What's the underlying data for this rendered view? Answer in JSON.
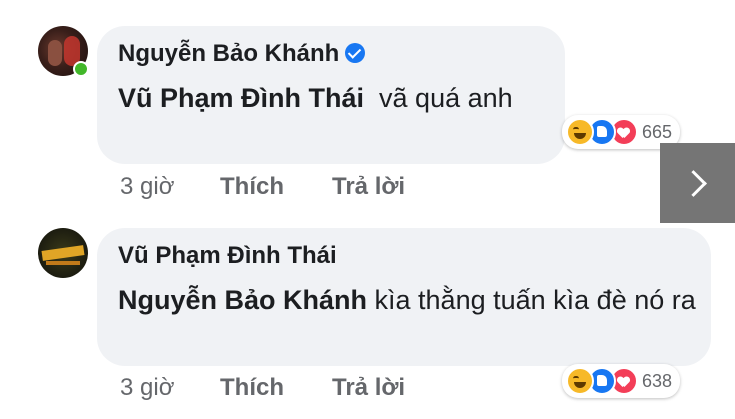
{
  "comments": [
    {
      "author": "Nguyễn Bảo Khánh",
      "verified": true,
      "mention": "Vũ Phạm Đình Thái",
      "text": "  vã quá anh",
      "reaction_count": "665",
      "time": "3 giờ",
      "like_label": "Thích",
      "reply_label": "Trả lời",
      "reaction_icons": [
        "haha-icon",
        "like-icon",
        "love-icon"
      ]
    },
    {
      "author": "Vũ Phạm Đình Thái",
      "verified": false,
      "mention": "Nguyễn Bảo Khánh",
      "text": " kìa thằng tuấn kìa đè nó ra",
      "reaction_count": "638",
      "time": "3 giờ",
      "like_label": "Thích",
      "reply_label": "Trả lời",
      "reaction_icons": [
        "haha-icon",
        "like-icon",
        "love-icon"
      ]
    }
  ],
  "colors": {
    "bubble": "#f0f2f5",
    "secondary_text": "#65676b",
    "verified": "#1877f2",
    "online": "#42b72a",
    "next_button": "#757575"
  },
  "next_button_icon": "chevron-right-icon"
}
